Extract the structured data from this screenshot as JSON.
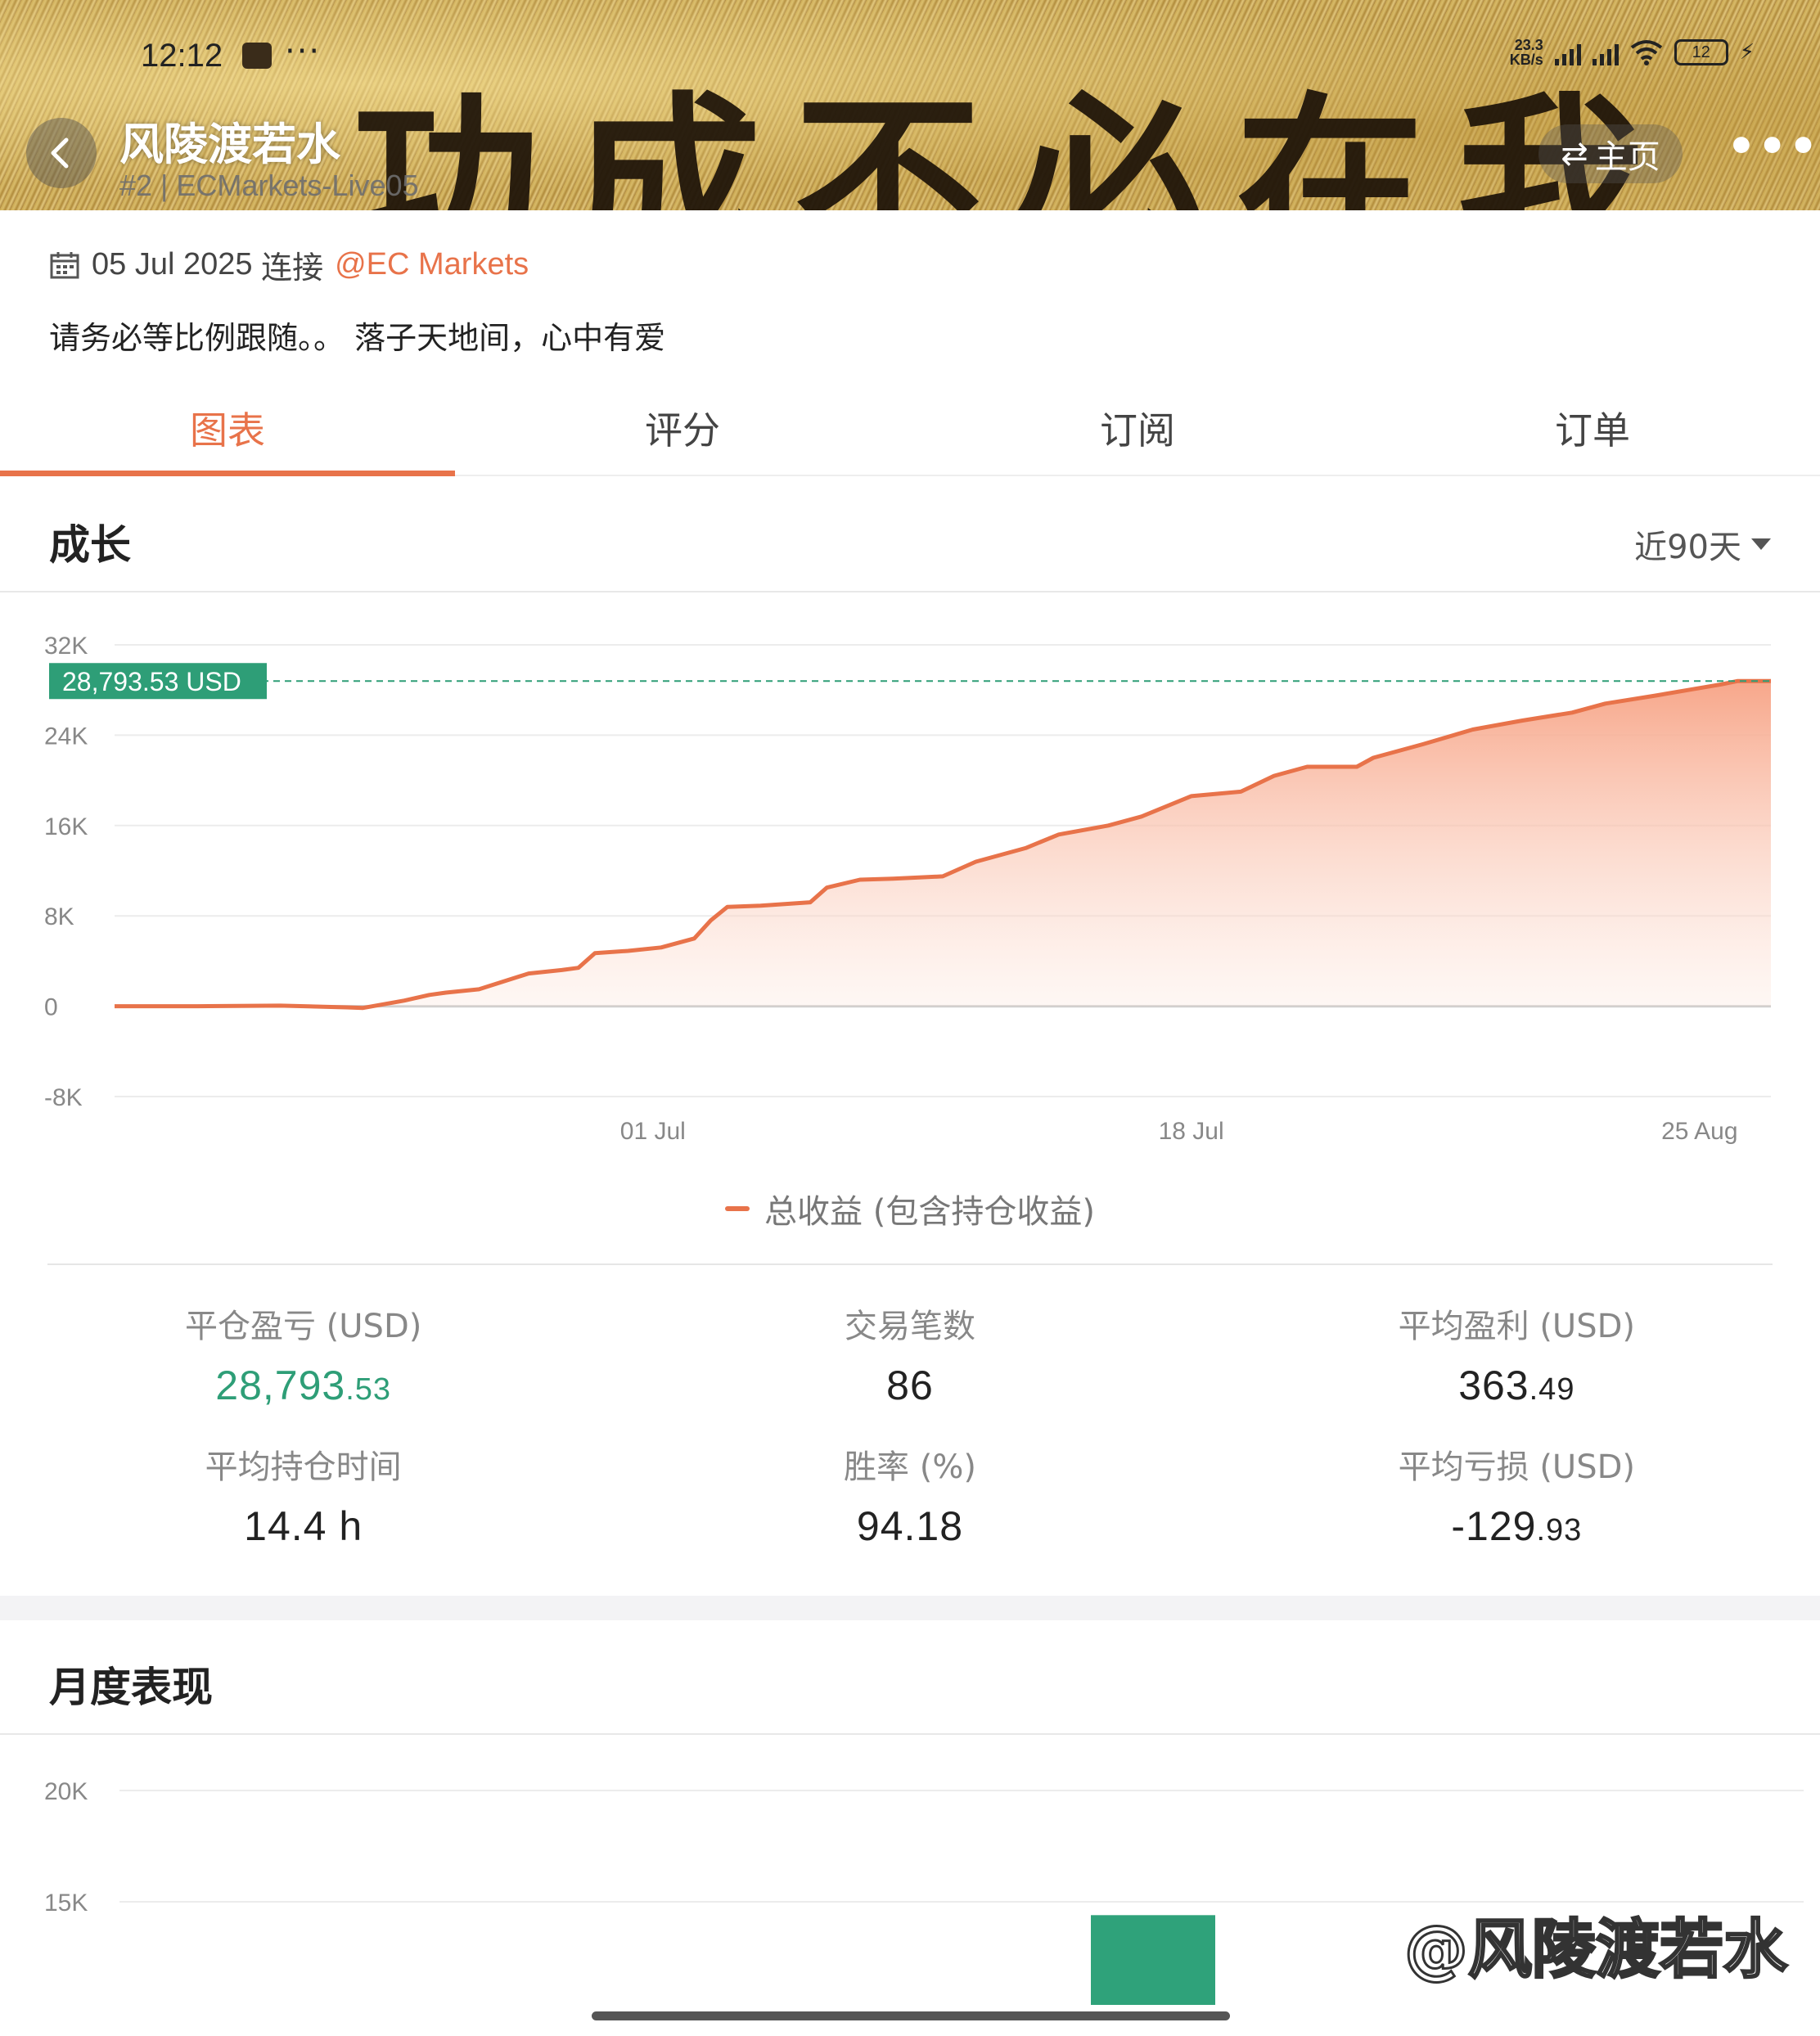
{
  "status_bar": {
    "time": "12:12",
    "net_speed_value": "23.3",
    "net_speed_unit": "KB/s",
    "network_1": "5G",
    "network_2": "5G",
    "battery": "12"
  },
  "header": {
    "banner_text": "功成不必在我",
    "trader_name": "风陵渡若水",
    "trader_sub": "#2 | ECMarkets-Live05",
    "home_label": "主页",
    "more_label": "•••",
    "back_icon": "chevron-left-icon"
  },
  "info": {
    "date": "05 Jul 2025",
    "connect_text": "连接",
    "broker": "@EC Markets",
    "description": "请务必等比例跟随。。 落子天地间，心中有爱"
  },
  "tabs": [
    {
      "label": "图表",
      "active": true
    },
    {
      "label": "评分",
      "active": false
    },
    {
      "label": "订阅",
      "active": false
    },
    {
      "label": "订单",
      "active": false
    }
  ],
  "growth": {
    "title": "成长",
    "period": "近90天",
    "legend": "总收益 (包含持仓收益)",
    "current_label": "28,793.53 USD"
  },
  "chart_data": [
    {
      "type": "area",
      "title": "成长",
      "ylim": [
        -8000,
        32000
      ],
      "yticks": [
        "32K",
        "24K",
        "16K",
        "8K",
        "0",
        "-8K"
      ],
      "ytick_values": [
        32000,
        24000,
        16000,
        8000,
        0,
        -8000
      ],
      "xtick_labels": [
        "01 Jul",
        "18 Jul",
        "25 Aug"
      ],
      "xtick_positions": [
        0.325,
        0.65,
        0.98
      ],
      "grid": true,
      "legend_position": "bottom",
      "series": [
        {
          "name": "总收益 (包含持仓收益)",
          "color": "#e8734a",
          "x": [
            0.0,
            0.05,
            0.1,
            0.14,
            0.15,
            0.175,
            0.19,
            0.2,
            0.22,
            0.25,
            0.27,
            0.28,
            0.29,
            0.31,
            0.33,
            0.35,
            0.36,
            0.37,
            0.39,
            0.42,
            0.43,
            0.45,
            0.47,
            0.5,
            0.52,
            0.55,
            0.57,
            0.6,
            0.62,
            0.65,
            0.68,
            0.7,
            0.72,
            0.75,
            0.76,
            0.79,
            0.82,
            0.85,
            0.88,
            0.9,
            0.93,
            0.95,
            0.97,
            0.98,
            1.0
          ],
          "values": [
            0,
            0,
            50,
            -100,
            -150,
            500,
            1000,
            1200,
            1500,
            2900,
            3200,
            3400,
            4700,
            4900,
            5200,
            6000,
            7600,
            8800,
            8900,
            9200,
            10500,
            11200,
            11300,
            11500,
            12800,
            14000,
            15200,
            16000,
            16800,
            18600,
            19000,
            20400,
            21200,
            21200,
            22000,
            23200,
            24500,
            25300,
            26000,
            26800,
            27500,
            28000,
            28500,
            28793.53,
            28793.53
          ]
        }
      ]
    },
    {
      "type": "bar",
      "title": "月度表现",
      "ylim": [
        0,
        20000
      ],
      "yticks": [
        "20K",
        "15K"
      ],
      "ytick_values": [
        20000,
        15000
      ],
      "grid": true,
      "series": [
        {
          "color": "#2fa27a",
          "values": [
            14400
          ]
        }
      ]
    }
  ],
  "stats": [
    {
      "label": "平仓盈亏 (USD)",
      "int": "28,793",
      "dec": ".53",
      "color": "green"
    },
    {
      "label": "交易笔数",
      "int": "86",
      "dec": "",
      "color": "normal"
    },
    {
      "label": "平均盈利 (USD)",
      "int": "363",
      "dec": ".49",
      "color": "normal"
    },
    {
      "label": "平均持仓时间",
      "int": "14.4 h",
      "dec": "",
      "color": "normal"
    },
    {
      "label": "胜率 (%)",
      "int": "94.18",
      "dec": "",
      "color": "normal"
    },
    {
      "label": "平均亏损 (USD)",
      "int": "-129",
      "dec": ".93",
      "color": "normal"
    }
  ],
  "monthly": {
    "title": "月度表现"
  },
  "watermark": "@风陵渡若水"
}
